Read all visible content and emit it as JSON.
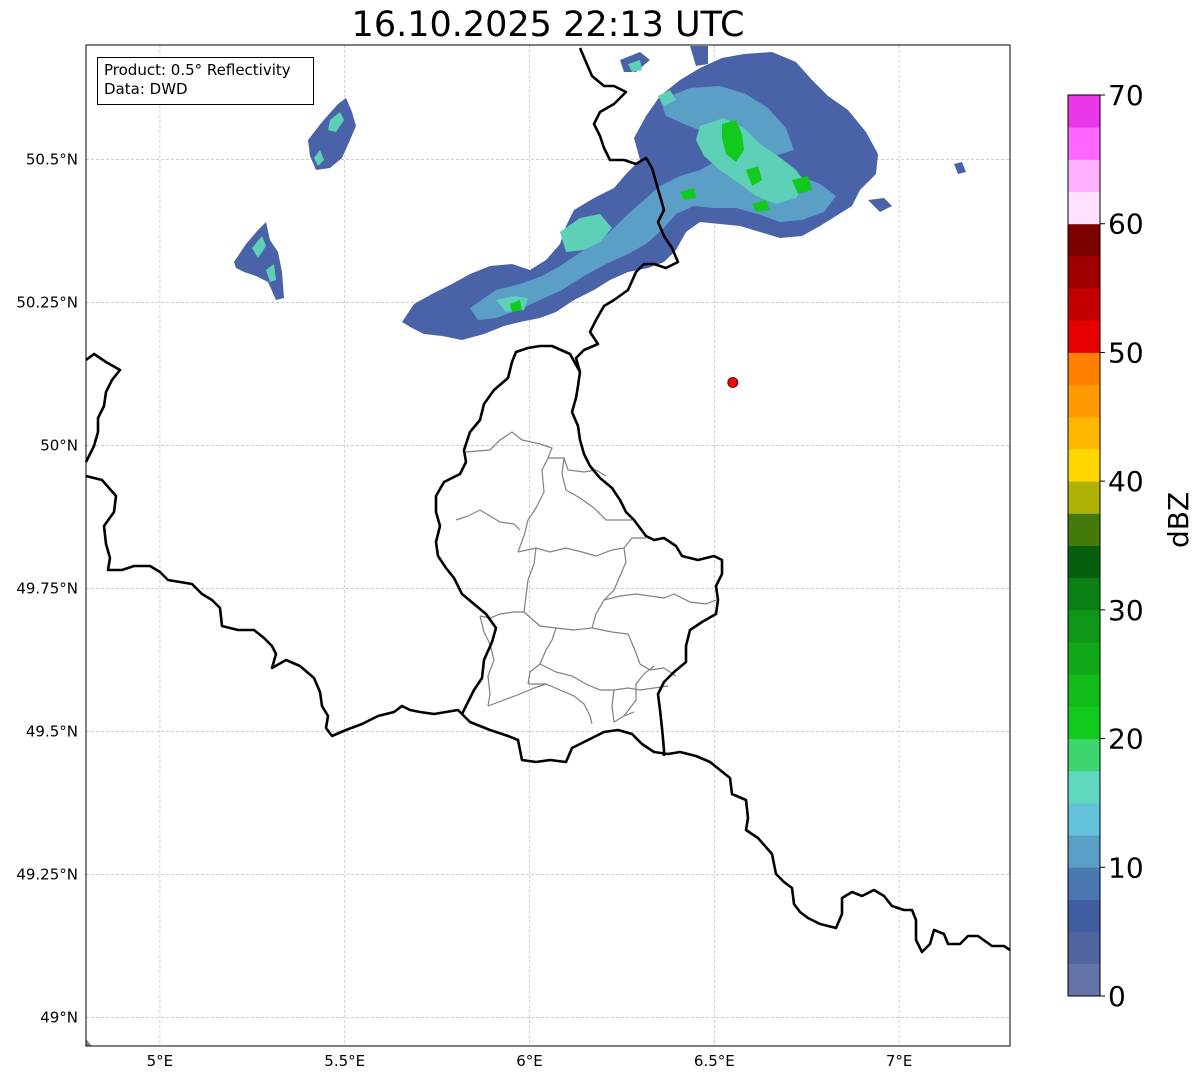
{
  "title": "16.10.2025 22:13 UTC",
  "info_box": {
    "product": "Product: 0.5° Reflectivity",
    "source": "Data: DWD"
  },
  "map": {
    "lon_range": [
      4.8,
      7.3
    ],
    "lat_range": [
      48.95,
      50.7
    ],
    "x_ticks": [
      {
        "value": 5.0,
        "label": "5°E"
      },
      {
        "value": 5.5,
        "label": "5.5°E"
      },
      {
        "value": 6.0,
        "label": "6°E"
      },
      {
        "value": 6.5,
        "label": "6.5°E"
      },
      {
        "value": 7.0,
        "label": "7°E"
      }
    ],
    "y_ticks": [
      {
        "value": 49.0,
        "label": "49°N"
      },
      {
        "value": 49.25,
        "label": "49.25°N"
      },
      {
        "value": 49.5,
        "label": "49.5°N"
      },
      {
        "value": 49.75,
        "label": "49.75°N"
      },
      {
        "value": 50.0,
        "label": "50°N"
      },
      {
        "value": 50.25,
        "label": "50.25°N"
      },
      {
        "value": 50.5,
        "label": "50.5°N"
      }
    ],
    "gridlines": true,
    "radar_site": {
      "lon": 6.55,
      "lat": 50.11,
      "color": "#ff0000"
    }
  },
  "colorbar": {
    "label": "dBZ",
    "min": 0,
    "max": 70,
    "step": 2.5,
    "tick_values": [
      0,
      10,
      20,
      30,
      40,
      50,
      60,
      70
    ],
    "tick_labels": [
      "0",
      "10",
      "20",
      "30",
      "40",
      "50",
      "60",
      "70"
    ],
    "colors": [
      "#6474a8",
      "#5166a0",
      "#415ea2",
      "#4a78b0",
      "#5b9ec6",
      "#63c2da",
      "#60d8c0",
      "#3dd56e",
      "#12c91e",
      "#10bb1a",
      "#10a818",
      "#0e9716",
      "#0b8014",
      "#075e0e",
      "#447a0a",
      "#afb305",
      "#ffd700",
      "#ffb700",
      "#ff9a00",
      "#ff8000",
      "#e60000",
      "#c40000",
      "#a10000",
      "#7d0000",
      "#ffe0ff",
      "#ffb0ff",
      "#ff66ff",
      "#e836e8"
    ]
  },
  "precip_colors": {
    "light": "#4a63a8",
    "medium": "#5b9ec6",
    "teal": "#5ed0b8",
    "green": "#12c91e"
  }
}
